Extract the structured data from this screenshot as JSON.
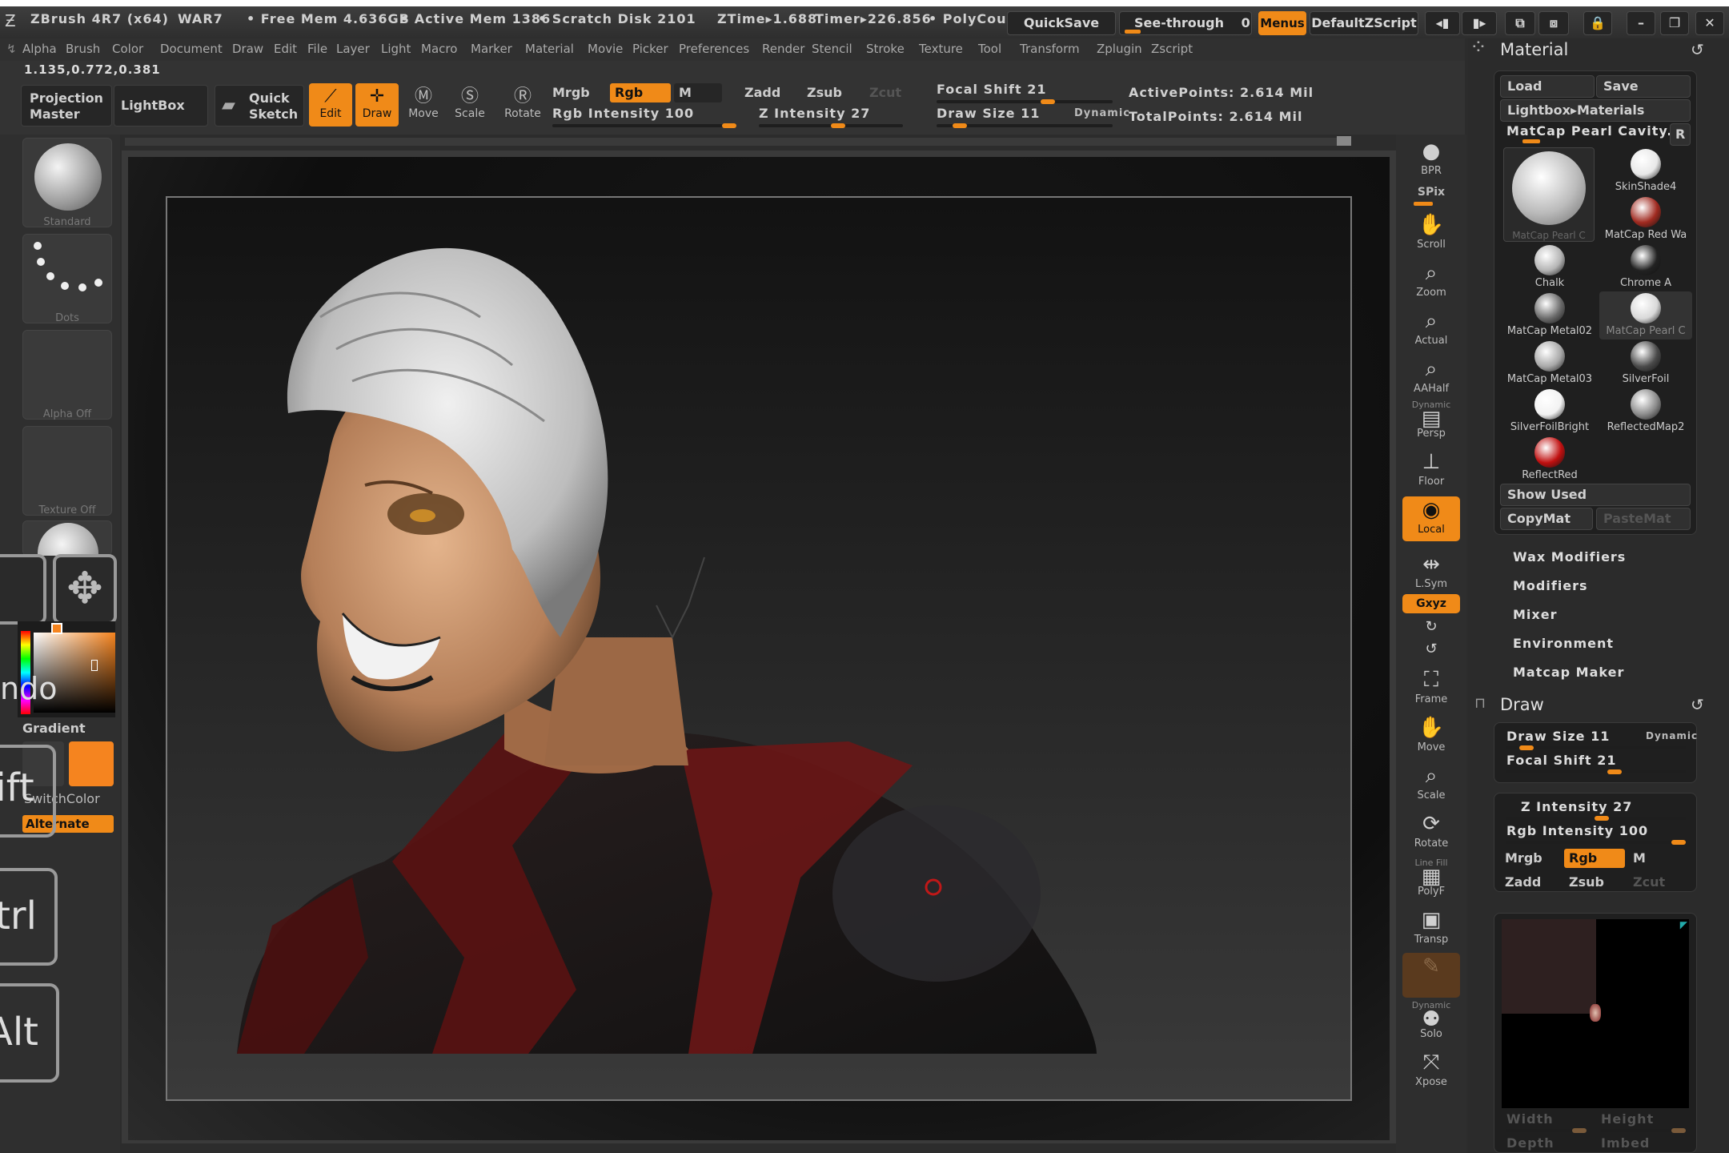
{
  "titlebar": {
    "app": "ZBrush 4R7 (x64)",
    "project": "WAR7",
    "free_mem": "• Free Mem 4.636GB",
    "active_mem": "• Active Mem 1386",
    "scratch": "• Scratch Disk 2101",
    "ztime": "ZTime▸1.688",
    "timer": "Timer▸226.856",
    "polycount": "• PolyCoun",
    "quicksave": "QuickSave",
    "see_through": "See-through",
    "see_through_value": "0",
    "menus": "Menus",
    "zscript": "DefaultZScript"
  },
  "menubar": [
    "Alpha",
    "Brush",
    "Color",
    "Document",
    "Draw",
    "Edit",
    "File",
    "Layer",
    "Light",
    "Macro",
    "Marker",
    "Material",
    "Movie",
    "Picker",
    "Preferences",
    "Render",
    "Stencil",
    "Stroke",
    "Texture",
    "Tool",
    "Transform",
    "Zplugin",
    "Zscript"
  ],
  "coords": "1.135,0.772,0.381",
  "shelf": {
    "projection_master": [
      "Projection",
      "Master"
    ],
    "lightbox": "LightBox",
    "quick_sketch": [
      "Quick",
      "Sketch"
    ],
    "edit": "Edit",
    "draw": "Draw",
    "move": "Move",
    "scale": "Scale",
    "rotate": "Rotate",
    "mrgb": "Mrgb",
    "rgb": "Rgb",
    "m": "M",
    "zadd": "Zadd",
    "zsub": "Zsub",
    "zcut": "Zcut",
    "rgb_intensity": "Rgb Intensity 100",
    "z_intensity": "Z Intensity 27",
    "focal_shift": "Focal Shift 21",
    "draw_size": "Draw Size 11",
    "dynamic": "Dynamic",
    "active_points": "ActivePoints: 2.614 Mil",
    "total_points": "TotalPoints: 2.614 Mil"
  },
  "leftshelf": {
    "standard": "Standard",
    "dots": "Dots",
    "alpha_off": "Alpha Off",
    "texture_off": "Texture Off",
    "gradient": "Gradient",
    "switchcolor": "SwitchColor",
    "alternate": "Alternate",
    "shift": "hift",
    "ctrl": "trl",
    "alt": "Alt",
    "undo": "ndo"
  },
  "righttools": [
    "BPR",
    "SPix",
    "Scroll",
    "Zoom",
    "Actual",
    "AAHalf",
    "Persp",
    "Floor",
    "Local",
    "L.Sym",
    "Gxyz",
    "",
    "",
    "Frame",
    "Move",
    "Scale",
    "Rotate",
    "PolyF",
    "Transp",
    "",
    "Solo",
    "Xpose"
  ],
  "righttools_extra": {
    "dynamic": "Dynamic",
    "line_fill": "Line Fill"
  },
  "material_panel": {
    "title": "Material",
    "load": "Load",
    "save": "Save",
    "lightbox_materials": "Lightbox▸Materials",
    "current": "MatCap Pearl Cavity.",
    "r": "R",
    "current_thumb_label": "MatCap Pearl C",
    "materials": [
      {
        "name": "SkinShade4",
        "color": "#e8e8e8"
      },
      {
        "name": "MatCap Red Wa",
        "color": "#a02a20"
      },
      {
        "name": "Chalk",
        "color": "#b4b4b4"
      },
      {
        "name": "Chrome A",
        "color": "#222222"
      },
      {
        "name": "MatCap Metal02",
        "color": "#6a6a6a"
      },
      {
        "name": "MatCap Pearl C",
        "color": "#d8d8d8"
      },
      {
        "name": "MatCap Metal03",
        "color": "#a8a8a8"
      },
      {
        "name": "SilverFoil",
        "color": "#4a4a4a"
      },
      {
        "name": "SilverFoilBright",
        "color": "#f2f2f2"
      },
      {
        "name": "ReflectedMap2",
        "color": "#8a8a8a"
      },
      {
        "name": "ReflectRed",
        "color": "#c01010"
      }
    ],
    "show_used": "Show Used",
    "copymat": "CopyMat",
    "pastemat": "PasteMat",
    "subs": [
      "Wax Modifiers",
      "Modifiers",
      "Mixer",
      "Environment",
      "Matcap Maker"
    ]
  },
  "draw_panel": {
    "title": "Draw",
    "draw_size": "Draw Size 11",
    "dynamic": "Dynamic",
    "focal_shift": "Focal Shift 21",
    "z_intensity": "Z Intensity 27",
    "rgb_intensity": "Rgb Intensity 100",
    "mrgb": "Mrgb",
    "rgb": "Rgb",
    "m": "M",
    "zadd": "Zadd",
    "zsub": "Zsub",
    "zcut": "Zcut",
    "width": "Width",
    "height": "Height",
    "depth": "Depth",
    "imbed": "Imbed"
  },
  "colors": {
    "accent": "#f08a18",
    "main_color": "#f5841f",
    "secondary_color": "#3a3a3a"
  }
}
